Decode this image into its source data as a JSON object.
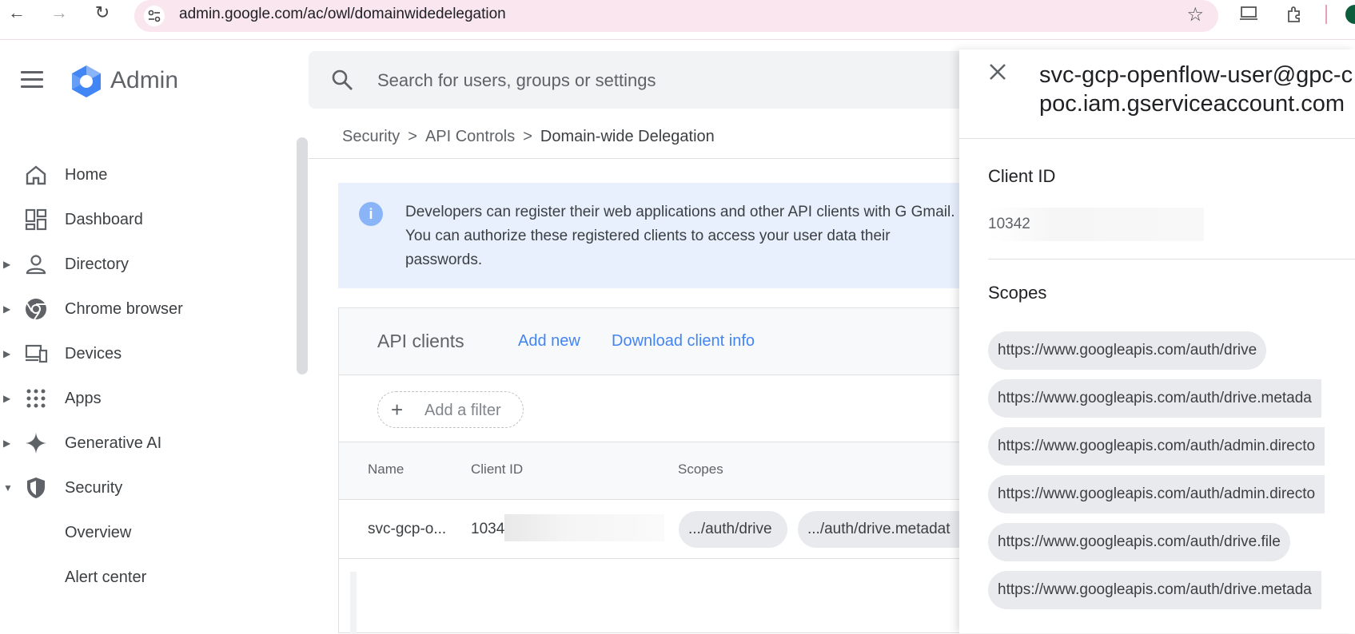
{
  "browser": {
    "url": "admin.google.com/ac/owl/domainwidedelegation"
  },
  "header": {
    "app_name": "Admin",
    "search_placeholder": "Search for users, groups or settings"
  },
  "sidebar": {
    "items": [
      {
        "label": "Home",
        "icon": "home-icon",
        "expandable": false
      },
      {
        "label": "Dashboard",
        "icon": "dashboard-icon",
        "expandable": false
      },
      {
        "label": "Directory",
        "icon": "person-icon",
        "expandable": true
      },
      {
        "label": "Chrome browser",
        "icon": "chrome-icon",
        "expandable": true
      },
      {
        "label": "Devices",
        "icon": "devices-icon",
        "expandable": true
      },
      {
        "label": "Apps",
        "icon": "apps-grid-icon",
        "expandable": true
      },
      {
        "label": "Generative AI",
        "icon": "sparkle-icon",
        "expandable": true
      },
      {
        "label": "Security",
        "icon": "shield-icon",
        "expandable": true,
        "expanded": true
      }
    ],
    "sub_items": [
      "Overview",
      "Alert center"
    ]
  },
  "breadcrumb": {
    "items": [
      "Security",
      "API Controls",
      "Domain-wide Delegation"
    ],
    "separator": ">"
  },
  "banner": {
    "text": "Developers can register their web applications and other API clients with G Gmail. You can authorize these registered clients to access your user data their passwords."
  },
  "api_clients": {
    "title": "API clients",
    "add_new": "Add new",
    "download": "Download client info",
    "filter_label": "Add a filter",
    "columns": [
      "Name",
      "Client ID",
      "Scopes"
    ],
    "rows": [
      {
        "name": "svc-gcp-o...",
        "client_id": "1034",
        "scopes": [
          ".../auth/drive",
          ".../auth/drive.metadat"
        ]
      }
    ]
  },
  "panel": {
    "title_line1": "svc-gcp-openflow-user@gpc-c",
    "title_line2": "poc.iam.gserviceaccount.com",
    "client_id_label": "Client ID",
    "client_id_value": "10342",
    "scopes_label": "Scopes",
    "scopes": [
      "https://www.googleapis.com/auth/drive",
      "https://www.googleapis.com/auth/drive.metada",
      "https://www.googleapis.com/auth/admin.directo",
      "https://www.googleapis.com/auth/admin.directo",
      "https://www.googleapis.com/auth/drive.file",
      "https://www.googleapis.com/auth/drive.metada"
    ]
  },
  "colors": {
    "omnibox": "#f9e6ee",
    "link": "#4285f4",
    "banner": "#e8f0fe",
    "chip": "#e8eaed"
  }
}
